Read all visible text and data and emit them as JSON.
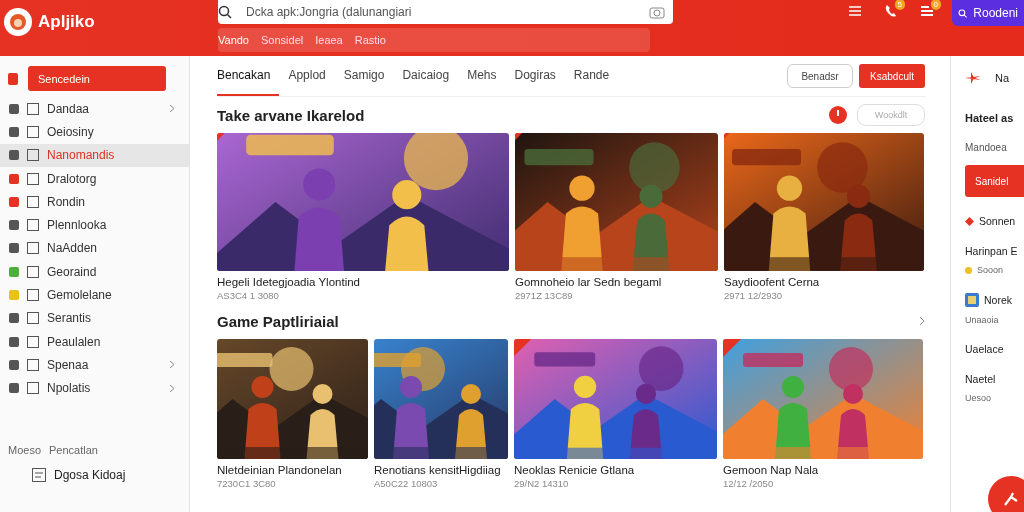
{
  "header": {
    "logo": "Apljiko",
    "search": {
      "placeholder": "Dcka apk:Jongria (dalunangiari"
    },
    "chips": [
      "Vando",
      "Sonsidel",
      "Ieaea",
      "Rastio"
    ],
    "badges": [
      "5",
      "0"
    ],
    "account_button": "Roodeni"
  },
  "sidebar": {
    "primary_button": "Sencedein",
    "items": [
      {
        "label": "Dandaa",
        "selected": false,
        "expandable": true,
        "color": "#555555"
      },
      {
        "label": "Oeiosiny",
        "selected": false,
        "expandable": false,
        "color": "#555555"
      },
      {
        "label": "Nanomandis",
        "selected": true,
        "expandable": false,
        "color": "#555555"
      },
      {
        "label": "Dralotorg",
        "selected": false,
        "expandable": false,
        "color": "#e53222"
      },
      {
        "label": "Rondin",
        "selected": false,
        "expandable": false,
        "color": "#e53222"
      },
      {
        "label": "Plennlooka",
        "selected": false,
        "expandable": false,
        "color": "#555555"
      },
      {
        "label": "NaAdden",
        "selected": false,
        "expandable": false,
        "color": "#555555"
      },
      {
        "label": "Georaind",
        "selected": false,
        "expandable": false,
        "color": "#4caf3a"
      },
      {
        "label": "Gemolelane",
        "selected": false,
        "expandable": false,
        "color": "#e8c21a"
      },
      {
        "label": "Serantis",
        "selected": false,
        "expandable": false,
        "color": "#555555"
      },
      {
        "label": "Peaulalen",
        "selected": false,
        "expandable": false,
        "color": "#555555"
      },
      {
        "label": "Spenaa",
        "selected": false,
        "expandable": true,
        "color": "#555555"
      },
      {
        "label": "Npolatis",
        "selected": false,
        "expandable": true,
        "color": "#555555"
      }
    ],
    "section_title": "Moeso",
    "section_subtitle": "Pencatlan",
    "section_items": [
      "Dgosa Kidoaj"
    ]
  },
  "main": {
    "tabs": [
      {
        "label": "Bencakan",
        "selected": true
      },
      {
        "label": "Applod",
        "selected": false
      },
      {
        "label": "Samigo",
        "selected": false
      },
      {
        "label": "Daicaiog",
        "selected": false
      },
      {
        "label": "Mehs",
        "selected": false
      },
      {
        "label": "Dogiras",
        "selected": false
      },
      {
        "label": "Rande",
        "selected": false
      }
    ],
    "outline_button": "Benadsr",
    "primary_button": "Ksabdcult",
    "sections": [
      {
        "title": "Take arvane Ikarelod",
        "filter": {
          "placeholder": "Wookdlt"
        },
        "cards": [
          {
            "title": "Hegeli Idetegjoadia Ylontind",
            "date": "AS3C4 1 3080"
          },
          {
            "title": "Gomnoheio lar Sedn begaml",
            "date": "2971Z 13C89"
          },
          {
            "title": "Saydioofent Cerna",
            "date": "2971 12/2930"
          }
        ]
      },
      {
        "title": "Game Paptliriaial",
        "cards": [
          {
            "title": "Nletdeinian Plandonelan",
            "date": "7230C1 3C80"
          },
          {
            "title": "Renotians kensitHigdiiag",
            "date": "A50C22 10803"
          },
          {
            "title": "Neoklas Renicie Gtlana",
            "date": "29/N2 14310"
          },
          {
            "title": "Gemoon Nap Nala",
            "date": "12/12 /2050"
          }
        ]
      }
    ]
  },
  "right_panel": {
    "heading": "Na",
    "title": "Hateel as",
    "subtitle": "Mandoea",
    "button": "Sanidel",
    "items": [
      "Sonnen",
      "Harinpan E",
      "Sooon",
      "Norek",
      "Unaaoia",
      "Uaelace",
      "Naetel",
      "Uesoo"
    ]
  }
}
